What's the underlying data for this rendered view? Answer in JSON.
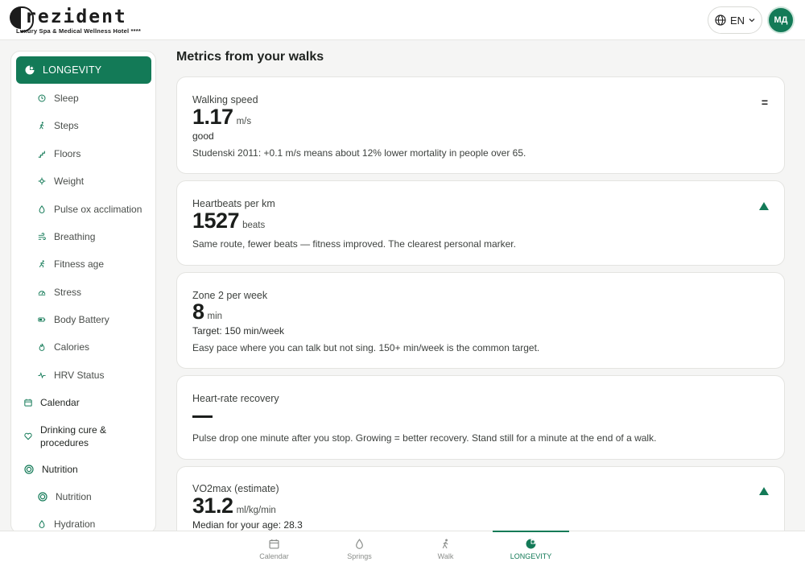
{
  "brand": {
    "name": "rezident",
    "tagline": "Luxury Spa & Medical Wellness Hotel ****"
  },
  "header": {
    "language": "EN",
    "avatar_initials": "МД"
  },
  "sidebar": {
    "active": {
      "label": "LONGEVITY",
      "icon": "longevity-icon"
    },
    "sub_items": [
      {
        "label": "Sleep",
        "icon": "clock-icon"
      },
      {
        "label": "Steps",
        "icon": "walking-icon"
      },
      {
        "label": "Floors",
        "icon": "stairs-icon"
      },
      {
        "label": "Weight",
        "icon": "scale-icon"
      },
      {
        "label": "Pulse ox acclimation",
        "icon": "drop-icon"
      },
      {
        "label": "Breathing",
        "icon": "wind-icon"
      },
      {
        "label": "Fitness age",
        "icon": "running-icon"
      },
      {
        "label": "Stress",
        "icon": "gauge-icon"
      },
      {
        "label": "Body Battery",
        "icon": "battery-icon"
      },
      {
        "label": "Calories",
        "icon": "flame-icon"
      },
      {
        "label": "HRV Status",
        "icon": "pulse-icon"
      }
    ],
    "calendar": "Calendar",
    "drinking_line1": "Drinking cure &",
    "drinking_line2": "procedures",
    "nutrition_group": "Nutrition",
    "nutrition_sub": "Nutrition",
    "hydration": "Hydration"
  },
  "main": {
    "title": "Metrics from your walks",
    "metrics": [
      {
        "label": "Walking speed",
        "value": "1.17",
        "unit": "m/s",
        "sub": "good",
        "desc": "Studenski 2011: +0.1 m/s means about 12% lower mortality in people over 65.",
        "trend": "="
      },
      {
        "label": "Heartbeats per km",
        "value": "1527",
        "unit": "beats",
        "desc": "Same route, fewer beats — fitness improved. The clearest personal marker.",
        "trend": "up"
      },
      {
        "label": "Zone 2 per week",
        "value": "8",
        "unit": "min",
        "sub": "Target: 150 min/week",
        "desc": "Easy pace where you can talk but not sing. 150+ min/week is the common target."
      },
      {
        "label": "Heart-rate recovery",
        "value": "—",
        "desc": "Pulse drop one minute after you stop. Growing = better recovery. Stand still for a minute at the end of a walk."
      },
      {
        "label": "VO2max (estimate)",
        "value": "31.2",
        "unit": "ml/kg/min",
        "sub": "Median for your age: 28.3",
        "trend": "up"
      }
    ]
  },
  "bottom_nav": [
    {
      "label": "Calendar",
      "icon": "calendar-icon"
    },
    {
      "label": "Springs",
      "icon": "drop-icon"
    },
    {
      "label": "Walk",
      "icon": "walking-icon"
    },
    {
      "label": "LONGEVITY",
      "icon": "longevity-icon",
      "active": true
    }
  ],
  "colors": {
    "accent": "#137a57",
    "background": "#f5f5f4"
  }
}
